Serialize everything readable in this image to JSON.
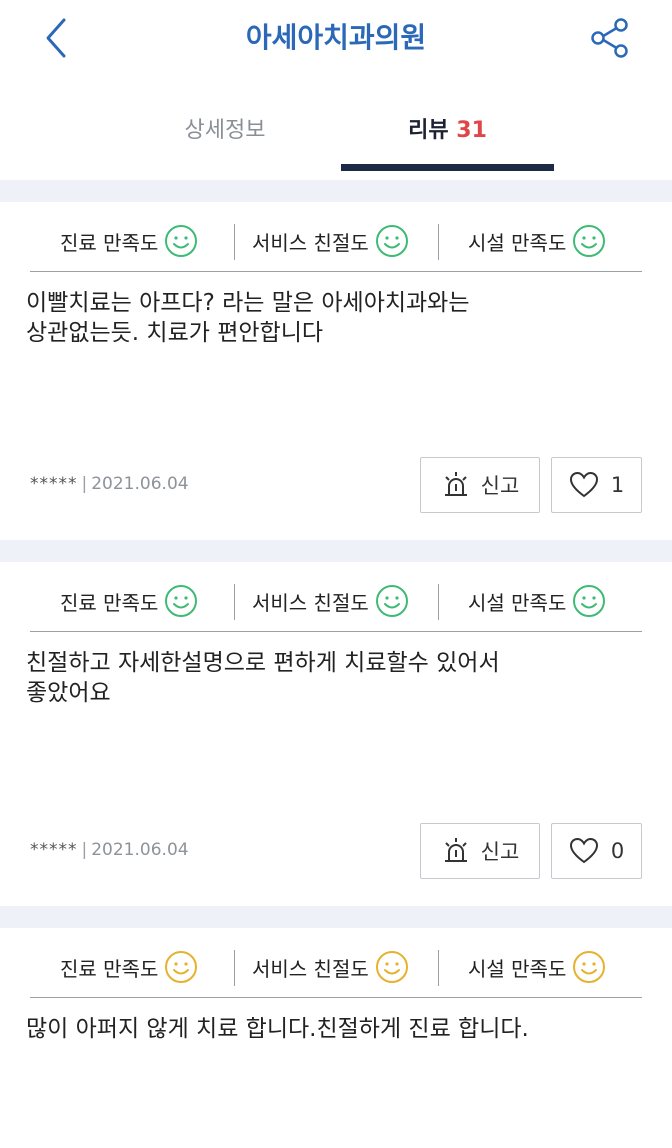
{
  "header": {
    "title": "아세아치과의원"
  },
  "tabs": {
    "detail_label": "상세정보",
    "review_label": "리뷰",
    "review_count": "31"
  },
  "rating_labels": {
    "treatment": "진료 만족도",
    "service": "서비스 친절도",
    "facility": "시설 만족도"
  },
  "colors": {
    "title": "#2b68b8",
    "count_red": "#e0454a",
    "face_green": "#3dbb74",
    "face_yellow": "#e6b22e",
    "separator": "#eef1f7"
  },
  "icons": {
    "back": "chevron-left-icon",
    "share": "share-icon",
    "report": "siren-icon",
    "like": "heart-icon",
    "rating_face": "smile-face-icon"
  },
  "reviews": [
    {
      "face_color": "green",
      "text": "이빨치료는 아프다? 라는 말은 아세아치과와는\n상관없는듯. 치료가 편안합니다",
      "author": "*****",
      "date": "2021.06.04",
      "report_label": "신고",
      "likes": "1"
    },
    {
      "face_color": "green",
      "text": "친절하고 자세한설명으로 편하게 치료할수 있어서\n좋았어요",
      "author": "*****",
      "date": "2021.06.04",
      "report_label": "신고",
      "likes": "0"
    },
    {
      "face_color": "yellow",
      "text": "많이 아퍼지 않게 치료 합니다.친절하게 진료 합니다.",
      "author": "",
      "date": "",
      "report_label": "",
      "likes": ""
    }
  ]
}
